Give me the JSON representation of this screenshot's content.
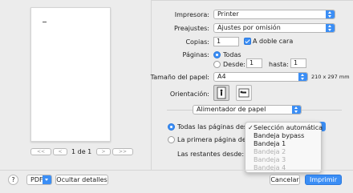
{
  "preview": {
    "page_label": "1 de 1",
    "first_btn": "<<",
    "prev_btn": "<",
    "next_btn": ">",
    "last_btn": ">>"
  },
  "printer": {
    "label": "Impresora:",
    "value": "Printer"
  },
  "presets": {
    "label": "Preajustes:",
    "value": "Ajustes por omisión"
  },
  "copies": {
    "label": "Copias:",
    "value": "1",
    "duplex_label": "A doble cara"
  },
  "pages": {
    "label": "Páginas:",
    "all_label": "Todas",
    "from_label": "Desde:",
    "from_value": "1",
    "to_label": "hasta:",
    "to_value": "1"
  },
  "paper_size": {
    "label": "Tamaño del papel:",
    "value": "A4",
    "dimensions": "210 x 297 mm"
  },
  "orientation": {
    "label": "Orientación:"
  },
  "section": {
    "value": "Alimentador de papel"
  },
  "feed": {
    "all_pages_label": "Todas las páginas desde",
    "first_page_label": "La primera página desde",
    "remaining_label": "Las restantes desde:"
  },
  "menu": {
    "items": [
      {
        "label": "Selección automática",
        "checked": true,
        "enabled": true
      },
      {
        "label": "Bandeja bypass",
        "checked": false,
        "enabled": true
      },
      {
        "label": "Bandeja 1",
        "checked": false,
        "enabled": true
      },
      {
        "label": "Bandeja 2",
        "checked": false,
        "enabled": false
      },
      {
        "label": "Bandeja 3",
        "checked": false,
        "enabled": false
      },
      {
        "label": "Bandeja 4",
        "checked": false,
        "enabled": false
      }
    ],
    "checkmark": "✓"
  },
  "footer": {
    "help": "?",
    "pdf": "PDF",
    "hide_details": "Ocultar detalles",
    "cancel": "Cancelar",
    "print": "Imprimir"
  },
  "colors": {
    "accent": "#3b8ef5"
  }
}
